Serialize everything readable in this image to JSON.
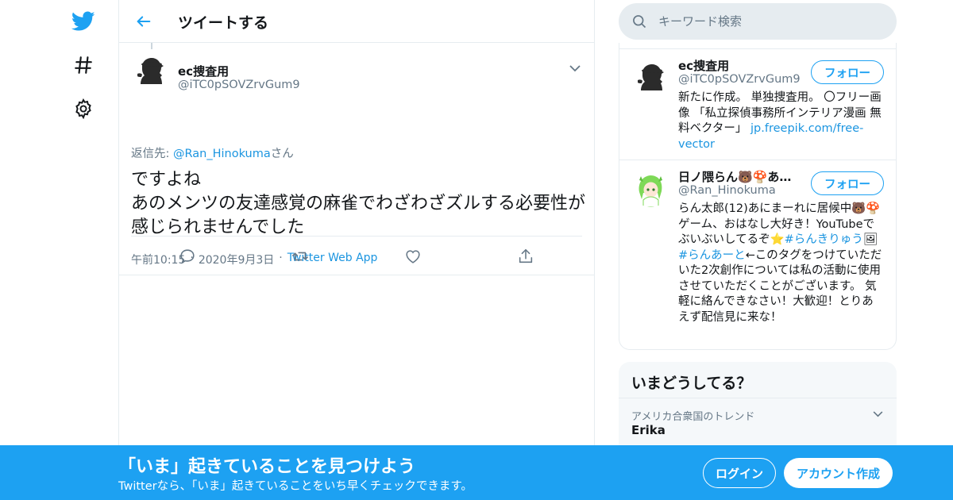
{
  "nav": {
    "items": [
      {
        "icon": "twitter-bird-icon"
      },
      {
        "icon": "hashtag-icon"
      },
      {
        "icon": "gear-icon"
      }
    ]
  },
  "header": {
    "title": "ツイートする"
  },
  "tweet": {
    "author_name": "ec捜査用",
    "author_handle": "@iTC0pSOVZrvGum9",
    "reply_prefix": "返信先: ",
    "reply_handle": "@Ran_Hinokuma",
    "reply_suffix": "さん",
    "text": "ですよね\nあのメンツの友達感覚の麻雀でわざわざズルする必要性が感じられませんでした",
    "time": "午前10:15",
    "date": "2020年9月3日",
    "source": "Twitter Web App",
    "separator": "·"
  },
  "search": {
    "placeholder": "キーワード検索"
  },
  "users": [
    {
      "name": "ec捜査用",
      "handle": "@iTC0pSOVZrvGum9",
      "follow_label": "フォロー",
      "bio_text": "新たに作成。 単独捜査用。 〇フリー画像 「私立探偵事務所インテリア漫画 無料ベクター」 ",
      "bio_link": "jp.freepik.com/free-vector"
    },
    {
      "name": "日ノ隈らん🐻🍄あ…",
      "handle": "@Ran_Hinokuma",
      "follow_label": "フォロー",
      "bio_part1": "らん太郎(12)あにまーれに居候中🐻🍄ゲーム、おはなし大好き！YouTubeでぶいぶいしてるぞ⭐",
      "bio_tag1": "#らんきりゅう",
      "bio_part2": "🖼",
      "bio_tag2": "#らんあーと",
      "bio_part3": "←このタグをつけていただいた2次創作については私の活動に使用させていただくことがございます。 気軽に絡んできなさい！大歓迎！とりあえず配信見に来な！"
    }
  ],
  "trends": {
    "title": "いまどうしてる？",
    "location": "アメリカ合衆国のトレンド",
    "items": [
      {
        "name": "Erika"
      }
    ]
  },
  "banner": {
    "title": "「いま」起きていることを見つけよう",
    "subtitle": "Twitterなら、「いま」起きていることをいち早くチェックできます。",
    "login_label": "ログイン",
    "signup_label": "アカウント作成"
  },
  "colors": {
    "brand": "#1da1f2",
    "link": "#1b95e0",
    "muted": "#657786",
    "border": "#e6ecf0"
  }
}
